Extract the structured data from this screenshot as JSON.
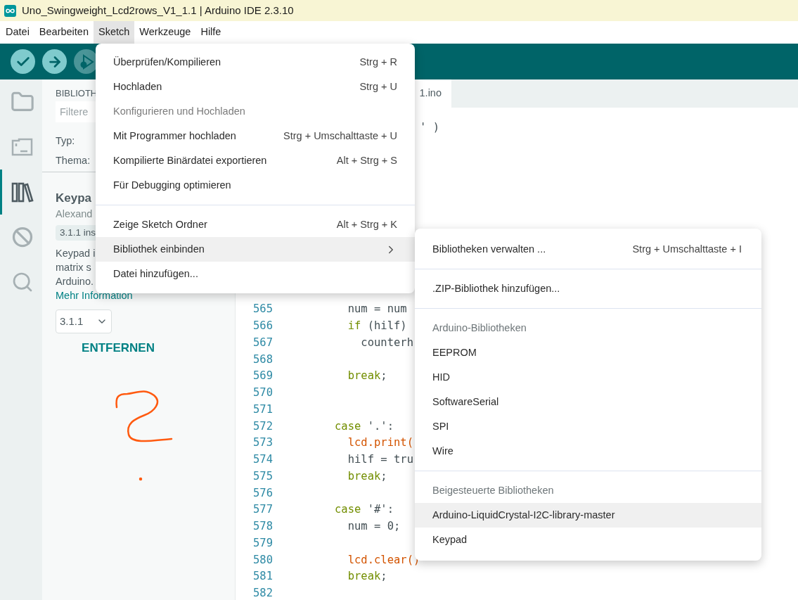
{
  "window": {
    "title": "Uno_Swingweight_Lcd2rows_V1_1.1 | Arduino IDE 2.3.10"
  },
  "menu_bar": [
    {
      "label": "Datei",
      "selected": false
    },
    {
      "label": "Bearbeiten",
      "selected": false
    },
    {
      "label": "Sketch",
      "selected": true
    },
    {
      "label": "Werkzeuge",
      "selected": false
    },
    {
      "label": "Hilfe",
      "selected": false
    }
  ],
  "toolbar": [
    {
      "kind": "verify",
      "disabled": false
    },
    {
      "kind": "upload",
      "disabled": false
    },
    {
      "kind": "debug",
      "disabled": true
    }
  ],
  "activity_bar": [
    {
      "kind": "folder",
      "selected": false
    },
    {
      "kind": "board",
      "selected": false
    },
    {
      "kind": "library",
      "selected": true
    },
    {
      "kind": "debug",
      "selected": false
    },
    {
      "kind": "search",
      "selected": false
    }
  ],
  "library_panel": {
    "heading": "BIBLIOTH",
    "filter": {
      "placeholder": "Filtere"
    },
    "type_label": "Typ:",
    "topic_label": "Thema:",
    "library": {
      "name": "Keypa",
      "author": "Alexand",
      "badge": "3.1.1 ins",
      "description": [
        "Keypad i",
        "matrix s",
        "Arduino."
      ],
      "more_link": "Mehr Information",
      "version": "3.1.1",
      "remove_button": "ENTFERNEN"
    }
  },
  "editor": {
    "tab": "1.ino",
    "fragment": "' )",
    "lines": [
      {
        "number": "565",
        "code": [
          {
            "kind": "plain",
            "text": "        num = num"
          }
        ]
      },
      {
        "number": "566",
        "code": [
          {
            "kind": "keyword",
            "text": "        if"
          },
          {
            "kind": "plain",
            "text": " (hilf)"
          }
        ]
      },
      {
        "number": "567",
        "code": [
          {
            "kind": "plain",
            "text": "          counterh"
          }
        ]
      },
      {
        "number": "568"
      },
      {
        "number": "569",
        "code": [
          {
            "kind": "keyword",
            "text": "        break"
          },
          {
            "kind": "plain",
            "text": ";"
          }
        ]
      },
      {
        "number": "570"
      },
      {
        "number": "571"
      },
      {
        "number": "572",
        "code": [
          {
            "kind": "keyword",
            "text": "      case"
          },
          {
            "kind": "plain",
            "text": " '.':"
          }
        ]
      },
      {
        "number": "573",
        "code": [
          {
            "kind": "function",
            "text": "        lcd.print("
          }
        ]
      },
      {
        "number": "574",
        "code": [
          {
            "kind": "plain",
            "text": "        hilf = tru"
          }
        ]
      },
      {
        "number": "575",
        "code": [
          {
            "kind": "keyword",
            "text": "        break"
          },
          {
            "kind": "plain",
            "text": ";"
          }
        ]
      },
      {
        "number": "576"
      },
      {
        "number": "577",
        "code": [
          {
            "kind": "keyword",
            "text": "      case"
          },
          {
            "kind": "plain",
            "text": " '#':"
          }
        ]
      },
      {
        "number": "578",
        "code": [
          {
            "kind": "plain",
            "text": "        num = 0;"
          }
        ]
      },
      {
        "number": "579"
      },
      {
        "number": "580",
        "code": [
          {
            "kind": "function",
            "text": "        lcd.clear()"
          }
        ]
      },
      {
        "number": "581",
        "code": [
          {
            "kind": "keyword",
            "text": "        break"
          },
          {
            "kind": "plain",
            "text": ";"
          }
        ]
      },
      {
        "number": "582"
      }
    ]
  },
  "sketch_menu": {
    "items": [
      {
        "kind": "item",
        "label": "Überprüfen/Kompilieren",
        "shortcut": "Strg + R",
        "disabled": false,
        "selected": false
      },
      {
        "kind": "item",
        "label": "Hochladen",
        "shortcut": "Strg + U",
        "disabled": false,
        "selected": false
      },
      {
        "kind": "item",
        "label": "Konfigurieren und Hochladen",
        "disabled": true,
        "selected": false
      },
      {
        "kind": "item",
        "label": "Mit Programmer hochladen",
        "shortcut": "Strg + Umschalttaste + U",
        "disabled": false,
        "selected": false
      },
      {
        "kind": "item",
        "label": "Kompilierte Binärdatei exportieren",
        "shortcut": "Alt + Strg + S",
        "disabled": false,
        "selected": false
      },
      {
        "kind": "item",
        "label": "Für Debugging optimieren",
        "disabled": false,
        "selected": false
      },
      {
        "kind": "separator"
      },
      {
        "kind": "item",
        "label": "Zeige Sketch Ordner",
        "shortcut": "Alt + Strg + K",
        "disabled": false,
        "selected": false
      },
      {
        "kind": "submenu",
        "label": "Bibliothek einbinden",
        "disabled": false,
        "selected": true
      },
      {
        "kind": "item",
        "label": "Datei hinzufügen...",
        "disabled": false,
        "selected": false
      }
    ]
  },
  "library_submenu": {
    "items": [
      {
        "kind": "item",
        "label": "Bibliotheken verwalten ...",
        "shortcut": "Strg + Umschalttaste + I",
        "selected": false
      },
      {
        "kind": "separator"
      },
      {
        "kind": "item",
        "label": ".ZIP-Bibliothek hinzufügen...",
        "selected": false
      },
      {
        "kind": "separator"
      },
      {
        "kind": "header",
        "label": "Arduino-Bibliotheken"
      },
      {
        "kind": "item",
        "label": "EEPROM",
        "selected": false
      },
      {
        "kind": "item",
        "label": "HID",
        "selected": false
      },
      {
        "kind": "item",
        "label": "SoftwareSerial",
        "selected": false
      },
      {
        "kind": "item",
        "label": "SPI",
        "selected": false
      },
      {
        "kind": "item",
        "label": "Wire",
        "selected": false
      },
      {
        "kind": "separator"
      },
      {
        "kind": "header",
        "label": "Beigesteuerte Bibliotheken"
      },
      {
        "kind": "item",
        "label": "Arduino-LiquidCrystal-I2C-library-master",
        "selected": true
      },
      {
        "kind": "item",
        "label": "Keypad",
        "selected": false
      }
    ]
  }
}
